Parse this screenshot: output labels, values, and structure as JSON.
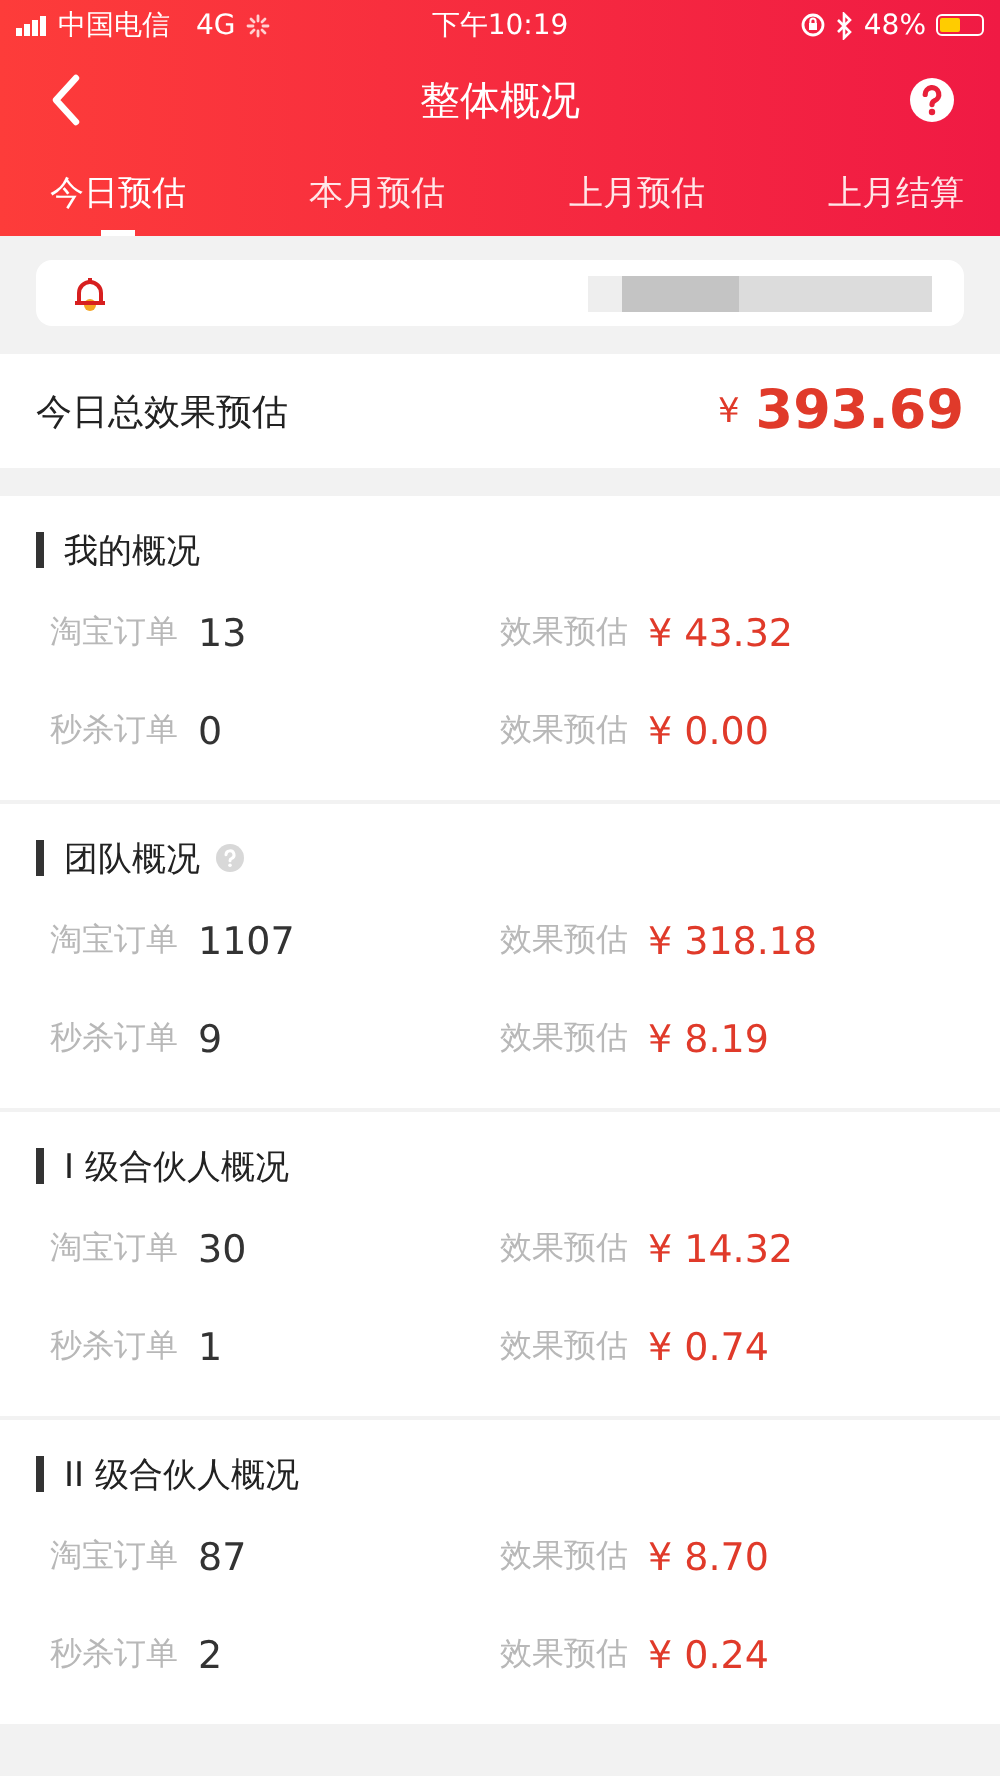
{
  "status_bar": {
    "carrier": "中国电信",
    "network": "4G",
    "time": "下午10:19",
    "battery": "48%"
  },
  "header": {
    "title": "整体概况"
  },
  "tabs": [
    {
      "label": "今日预估",
      "selected": true
    },
    {
      "label": "本月预估",
      "selected": false
    },
    {
      "label": "上月预估",
      "selected": false
    },
    {
      "label": "上月结算",
      "selected": false
    }
  ],
  "total": {
    "label": "今日总效果预估",
    "currency": "¥",
    "amount": "393.69"
  },
  "sections": [
    {
      "title": "我的概况",
      "help": false,
      "rows": [
        {
          "label": "淘宝订单",
          "count": "13",
          "estimate_label": "效果预估",
          "amount": "¥ 43.32"
        },
        {
          "label": "秒杀订单",
          "count": "0",
          "estimate_label": "效果预估",
          "amount": "¥ 0.00"
        }
      ]
    },
    {
      "title": "团队概况",
      "help": true,
      "rows": [
        {
          "label": "淘宝订单",
          "count": "1107",
          "estimate_label": "效果预估",
          "amount": "¥ 318.18"
        },
        {
          "label": "秒杀订单",
          "count": "9",
          "estimate_label": "效果预估",
          "amount": "¥ 8.19"
        }
      ]
    },
    {
      "title": "I 级合伙人概况",
      "help": false,
      "rows": [
        {
          "label": "淘宝订单",
          "count": "30",
          "estimate_label": "效果预估",
          "amount": "¥ 14.32"
        },
        {
          "label": "秒杀订单",
          "count": "1",
          "estimate_label": "效果预估",
          "amount": "¥ 0.74"
        }
      ]
    },
    {
      "title": "II 级合伙人概况",
      "help": false,
      "rows": [
        {
          "label": "淘宝订单",
          "count": "87",
          "estimate_label": "效果预估",
          "amount": "¥ 8.70"
        },
        {
          "label": "秒杀订单",
          "count": "2",
          "estimate_label": "效果预估",
          "amount": "¥ 0.24"
        }
      ]
    }
  ]
}
